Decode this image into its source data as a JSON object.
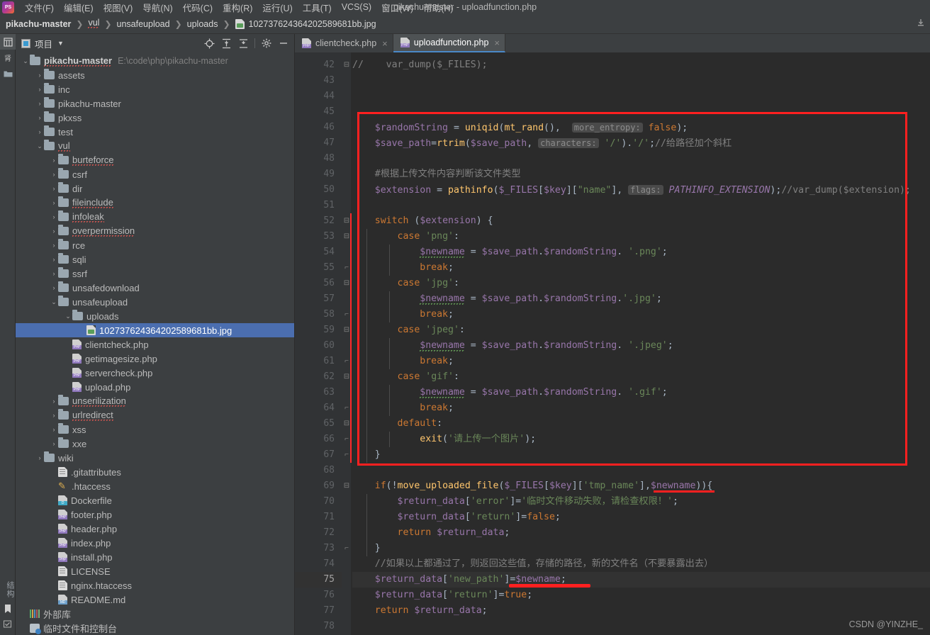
{
  "window": {
    "title": "pikachu-master - uploadfunction.php"
  },
  "menubar": {
    "logo": "phpstorm-logo-icon",
    "items": [
      {
        "label": "文件(F)"
      },
      {
        "label": "编辑(E)"
      },
      {
        "label": "视图(V)"
      },
      {
        "label": "导航(N)"
      },
      {
        "label": "代码(C)"
      },
      {
        "label": "重构(R)"
      },
      {
        "label": "运行(U)"
      },
      {
        "label": "工具(T)"
      },
      {
        "label": "VCS(S)"
      },
      {
        "label": "窗口(W)"
      },
      {
        "label": "帮助(H)"
      }
    ]
  },
  "breadcrumb": {
    "items": [
      "pikachu-master",
      "vul",
      "unsafeupload",
      "uploads",
      "102737624364202589681bb.jpg"
    ]
  },
  "toolstrip": {
    "top": [
      "项目",
      "结构"
    ],
    "bottom": [
      "结构",
      "书签",
      "待办"
    ]
  },
  "project_panel": {
    "title": "项目",
    "caret": "chevron-down-icon",
    "tools": [
      "locate-icon",
      "expand-all-icon",
      "collapse-all-icon",
      "settings-icon",
      "hide-icon"
    ],
    "tree": [
      {
        "depth": 0,
        "arrow": "down",
        "icon": "folder",
        "label": "pikachu-master",
        "bold": true,
        "hint": "E:\\code\\php\\pikachu-master",
        "spell": true
      },
      {
        "depth": 1,
        "arrow": "right",
        "icon": "folder",
        "label": "assets"
      },
      {
        "depth": 1,
        "arrow": "right",
        "icon": "folder",
        "label": "inc"
      },
      {
        "depth": 1,
        "arrow": "right",
        "icon": "folder",
        "label": "pikachu-master"
      },
      {
        "depth": 1,
        "arrow": "right",
        "icon": "folder",
        "label": "pkxss"
      },
      {
        "depth": 1,
        "arrow": "right",
        "icon": "folder",
        "label": "test"
      },
      {
        "depth": 1,
        "arrow": "down",
        "icon": "folder",
        "label": "vul",
        "spell": true
      },
      {
        "depth": 2,
        "arrow": "right",
        "icon": "folder",
        "label": "burteforce",
        "spell": true
      },
      {
        "depth": 2,
        "arrow": "right",
        "icon": "folder",
        "label": "csrf"
      },
      {
        "depth": 2,
        "arrow": "right",
        "icon": "folder",
        "label": "dir"
      },
      {
        "depth": 2,
        "arrow": "right",
        "icon": "folder",
        "label": "fileinclude",
        "spell": true
      },
      {
        "depth": 2,
        "arrow": "right",
        "icon": "folder",
        "label": "infoleak",
        "spell": true
      },
      {
        "depth": 2,
        "arrow": "right",
        "icon": "folder",
        "label": "overpermission",
        "spell": true
      },
      {
        "depth": 2,
        "arrow": "right",
        "icon": "folder",
        "label": "rce"
      },
      {
        "depth": 2,
        "arrow": "right",
        "icon": "folder",
        "label": "sqli"
      },
      {
        "depth": 2,
        "arrow": "right",
        "icon": "folder",
        "label": "ssrf"
      },
      {
        "depth": 2,
        "arrow": "right",
        "icon": "folder",
        "label": "unsafedownload"
      },
      {
        "depth": 2,
        "arrow": "down",
        "icon": "folder",
        "label": "unsafeupload"
      },
      {
        "depth": 3,
        "arrow": "down",
        "icon": "folder",
        "label": "uploads"
      },
      {
        "depth": 4,
        "arrow": "none",
        "icon": "image",
        "label": "102737624364202589681bb.jpg",
        "selected": true
      },
      {
        "depth": 3,
        "arrow": "none",
        "icon": "php",
        "label": "clientcheck.php"
      },
      {
        "depth": 3,
        "arrow": "none",
        "icon": "php",
        "label": "getimagesize.php"
      },
      {
        "depth": 3,
        "arrow": "none",
        "icon": "php",
        "label": "servercheck.php"
      },
      {
        "depth": 3,
        "arrow": "none",
        "icon": "php",
        "label": "upload.php"
      },
      {
        "depth": 2,
        "arrow": "right",
        "icon": "folder",
        "label": "unserilization",
        "spell": true
      },
      {
        "depth": 2,
        "arrow": "right",
        "icon": "folder",
        "label": "urlredirect",
        "spell": true
      },
      {
        "depth": 2,
        "arrow": "right",
        "icon": "folder",
        "label": "xss"
      },
      {
        "depth": 2,
        "arrow": "right",
        "icon": "folder",
        "label": "xxe"
      },
      {
        "depth": 1,
        "arrow": "right",
        "icon": "folder",
        "label": "wiki"
      },
      {
        "depth": 2,
        "arrow": "none",
        "icon": "txt",
        "label": ".gitattributes"
      },
      {
        "depth": 2,
        "arrow": "none",
        "icon": "pen",
        "label": ".htaccess"
      },
      {
        "depth": 2,
        "arrow": "none",
        "icon": "docker",
        "label": "Dockerfile"
      },
      {
        "depth": 2,
        "arrow": "none",
        "icon": "php",
        "label": "footer.php"
      },
      {
        "depth": 2,
        "arrow": "none",
        "icon": "php",
        "label": "header.php"
      },
      {
        "depth": 2,
        "arrow": "none",
        "icon": "php",
        "label": "index.php"
      },
      {
        "depth": 2,
        "arrow": "none",
        "icon": "php",
        "label": "install.php"
      },
      {
        "depth": 2,
        "arrow": "none",
        "icon": "txt",
        "label": "LICENSE"
      },
      {
        "depth": 2,
        "arrow": "none",
        "icon": "txt",
        "label": "nginx.htaccess"
      },
      {
        "depth": 2,
        "arrow": "none",
        "icon": "md",
        "label": "README.md"
      },
      {
        "depth": 0,
        "arrow": "none",
        "icon": "lib",
        "label": "外部库"
      },
      {
        "depth": 0,
        "arrow": "none",
        "icon": "console",
        "label": "临时文件和控制台"
      }
    ]
  },
  "editor": {
    "tabs": [
      {
        "label": "clientcheck.php",
        "active": false,
        "close": "×"
      },
      {
        "label": "uploadfunction.php",
        "active": true,
        "close": "×"
      }
    ],
    "first_line": 42,
    "current_line": 75,
    "lines": [
      {
        "n": 42,
        "fold": "minus",
        "html": "<span class=\"c-cmt\">//    var_dump($_FILES);</span>"
      },
      {
        "n": 43,
        "html": ""
      },
      {
        "n": 44,
        "html": ""
      },
      {
        "n": 45,
        "html": ""
      },
      {
        "n": 46,
        "html": "    <span class=\"c-var\">$randomString</span> <span class=\"c-txt\">=</span> <span class=\"c-fn\">uniqid</span><span class=\"c-txt\">(</span><span class=\"c-fn\">mt_rand</span><span class=\"c-txt\">(),</span>  <span class=\"hint\">more_entropy:</span> <span class=\"c-kw\">false</span><span class=\"c-txt\">);</span>"
      },
      {
        "n": 47,
        "html": "    <span class=\"c-var\">$save_path</span><span class=\"c-txt\">=</span><span class=\"c-fn\">rtrim</span><span class=\"c-txt\">(</span><span class=\"c-var\">$save_path</span><span class=\"c-txt\">,</span> <span class=\"hint\">characters:</span> <span class=\"c-str\">'/'</span><span class=\"c-txt\">).</span><span class=\"c-str\">'/'</span><span class=\"c-txt\">;</span><span class=\"c-cmt\">//给路径加个斜杠</span>"
      },
      {
        "n": 48,
        "html": ""
      },
      {
        "n": 49,
        "html": "    <span class=\"c-cmt\">#根据上传文件内容判断该文件类型</span>"
      },
      {
        "n": 50,
        "html": "    <span class=\"c-var\">$extension</span> <span class=\"c-txt\">=</span> <span class=\"c-fn\">pathinfo</span><span class=\"c-txt\">(</span><span class=\"c-var\">$_FILES</span><span class=\"c-txt\">[</span><span class=\"c-var\">$key</span><span class=\"c-txt\">][</span><span class=\"c-str\">\"name\"</span><span class=\"c-txt\">],</span> <span class=\"hint\">flags:</span> <span class=\"c-const\">PATHINFO_EXTENSION</span><span class=\"c-txt\">);</span><span class=\"c-cmt\">//var_dump($extension);</span>"
      },
      {
        "n": 51,
        "html": ""
      },
      {
        "n": 52,
        "fold": "minus",
        "html": "    <span class=\"c-kw\">switch</span> <span class=\"c-txt\">(</span><span class=\"c-var\">$extension</span><span class=\"c-txt\">) {</span>"
      },
      {
        "n": 53,
        "fold": "minus",
        "html": "        <span class=\"c-kw\">case</span> <span class=\"c-str\">'png'</span><span class=\"c-txt\">:</span>"
      },
      {
        "n": 54,
        "html": "            <span class=\"c-var greensq\">$newname</span> <span class=\"c-txt\">=</span> <span class=\"c-var\">$save_path</span><span class=\"c-txt\">.</span><span class=\"c-var\">$randomString</span><span class=\"c-txt\">.</span> <span class=\"c-str\">'.png'</span><span class=\"c-txt\">;</span>"
      },
      {
        "n": 55,
        "fold": "end",
        "html": "            <span class=\"c-kw\">break</span><span class=\"c-txt\">;</span>"
      },
      {
        "n": 56,
        "fold": "minus",
        "html": "        <span class=\"c-kw\">case</span> <span class=\"c-str\">'jpg'</span><span class=\"c-txt\">:</span>"
      },
      {
        "n": 57,
        "html": "            <span class=\"c-var greensq\">$newname</span> <span class=\"c-txt\">=</span> <span class=\"c-var\">$save_path</span><span class=\"c-txt\">.</span><span class=\"c-var\">$randomString</span><span class=\"c-txt\">.</span><span class=\"c-str\">'.jpg'</span><span class=\"c-txt\">;</span>"
      },
      {
        "n": 58,
        "fold": "end",
        "html": "            <span class=\"c-kw\">break</span><span class=\"c-txt\">;</span>"
      },
      {
        "n": 59,
        "fold": "minus",
        "html": "        <span class=\"c-kw\">case</span> <span class=\"c-str\">'jpeg'</span><span class=\"c-txt\">:</span>"
      },
      {
        "n": 60,
        "html": "            <span class=\"c-var greensq\">$newname</span> <span class=\"c-txt\">=</span> <span class=\"c-var\">$save_path</span><span class=\"c-txt\">.</span><span class=\"c-var\">$randomString</span><span class=\"c-txt\">.</span> <span class=\"c-str\">'.jpeg'</span><span class=\"c-txt\">;</span>"
      },
      {
        "n": 61,
        "fold": "end",
        "html": "            <span class=\"c-kw\">break</span><span class=\"c-txt\">;</span>"
      },
      {
        "n": 62,
        "fold": "minus",
        "html": "        <span class=\"c-kw\">case</span> <span class=\"c-str\">'gif'</span><span class=\"c-txt\">:</span>"
      },
      {
        "n": 63,
        "html": "            <span class=\"c-var greensq\">$newname</span> <span class=\"c-txt\">=</span> <span class=\"c-var\">$save_path</span><span class=\"c-txt\">.</span><span class=\"c-var\">$randomString</span><span class=\"c-txt\">.</span> <span class=\"c-str\">'.gif'</span><span class=\"c-txt\">;</span>"
      },
      {
        "n": 64,
        "fold": "end",
        "html": "            <span class=\"c-kw\">break</span><span class=\"c-txt\">;</span>"
      },
      {
        "n": 65,
        "fold": "minus",
        "html": "        <span class=\"c-kw\">default</span><span class=\"c-txt\">:</span>"
      },
      {
        "n": 66,
        "fold": "end",
        "html": "            <span class=\"c-fn\">exit</span><span class=\"c-txt\">(</span><span class=\"c-str\">'请上传一个图片'</span><span class=\"c-txt\">);</span>"
      },
      {
        "n": 67,
        "fold": "end",
        "html": "    <span class=\"c-txt\">}</span>"
      },
      {
        "n": 68,
        "html": ""
      },
      {
        "n": 69,
        "fold": "minus",
        "html": "    <span class=\"c-kw\">if</span><span class=\"c-txt\">(!</span><span class=\"c-fn\">move_uploaded_file</span><span class=\"c-txt\">(</span><span class=\"c-var\">$_FILES</span><span class=\"c-txt\">[</span><span class=\"c-var\">$key</span><span class=\"c-txt\">][</span><span class=\"c-str\">'tmp_name'</span><span class=\"c-txt\">],</span><span class=\"c-var\">$newname</span><span class=\"c-txt\">)){</span>"
      },
      {
        "n": 70,
        "html": "        <span class=\"c-var\">$return_data</span><span class=\"c-txt\">[</span><span class=\"c-str\">'error'</span><span class=\"c-txt\">]=</span><span class=\"c-str\">'临时文件移动失败，请检查权限！'</span><span class=\"c-txt\">;</span>"
      },
      {
        "n": 71,
        "html": "        <span class=\"c-var\">$return_data</span><span class=\"c-txt\">[</span><span class=\"c-str\">'return'</span><span class=\"c-txt\">]=</span><span class=\"c-kw\">false</span><span class=\"c-txt\">;</span>"
      },
      {
        "n": 72,
        "html": "        <span class=\"c-kw\">return</span> <span class=\"c-var\">$return_data</span><span class=\"c-txt\">;</span>"
      },
      {
        "n": 73,
        "fold": "end",
        "html": "    <span class=\"c-txt\">}</span>"
      },
      {
        "n": 74,
        "html": "    <span class=\"c-cmt\">//如果以上都通过了，则返回这些值，存储的路径，新的文件名（不要暴露出去）</span>"
      },
      {
        "n": 75,
        "html": "    <span class=\"c-var\">$return_data</span><span class=\"c-txt\">[</span><span class=\"c-str\">'new_path'</span><span class=\"c-txt\">]=</span><span class=\"c-var\">$newname</span><span class=\"c-txt\">;</span>"
      },
      {
        "n": 76,
        "html": "    <span class=\"c-var\">$return_data</span><span class=\"c-txt\">[</span><span class=\"c-str\">'return'</span><span class=\"c-txt\">]=</span><span class=\"c-kw\">true</span><span class=\"c-txt\">;</span>"
      },
      {
        "n": 77,
        "html": "    <span class=\"c-kw\">return</span> <span class=\"c-var\">$return_data</span><span class=\"c-txt\">;</span>"
      },
      {
        "n": 78,
        "html": ""
      }
    ]
  },
  "annotations": {
    "box_color": "#ff2020",
    "underline_color": "#ff2020",
    "box_label": "red-rectangle-around-switch-block",
    "underline1_label": "red-underline-newname-line-69",
    "underline2_label": "red-underline-newname-line-75"
  },
  "watermark": {
    "text": "CSDN @YINZHE_"
  }
}
